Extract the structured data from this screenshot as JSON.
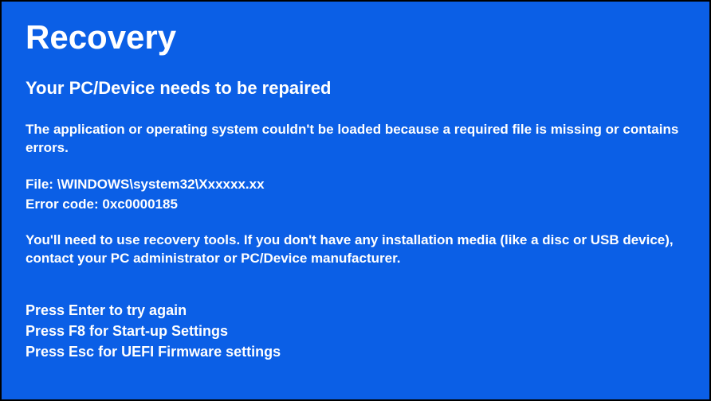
{
  "title": "Recovery",
  "subtitle": "Your PC/Device needs to be repaired",
  "error_message": "The application or operating system couldn't be loaded because a required file is missing or contains errors.",
  "file_label": "File:",
  "file_path": "\\WINDOWS\\system32\\Xxxxxx.xx",
  "error_code_label": "Error code:",
  "error_code": "0xc0000185",
  "instructions": "You'll need to use recovery tools. If you don't have any installation media (like a disc or USB device), contact your PC administrator or PC/Device manufacturer.",
  "actions": {
    "enter": "Press Enter to try again",
    "f8": "Press F8 for Start-up Settings",
    "esc": "Press Esc for UEFI Firmware settings"
  }
}
